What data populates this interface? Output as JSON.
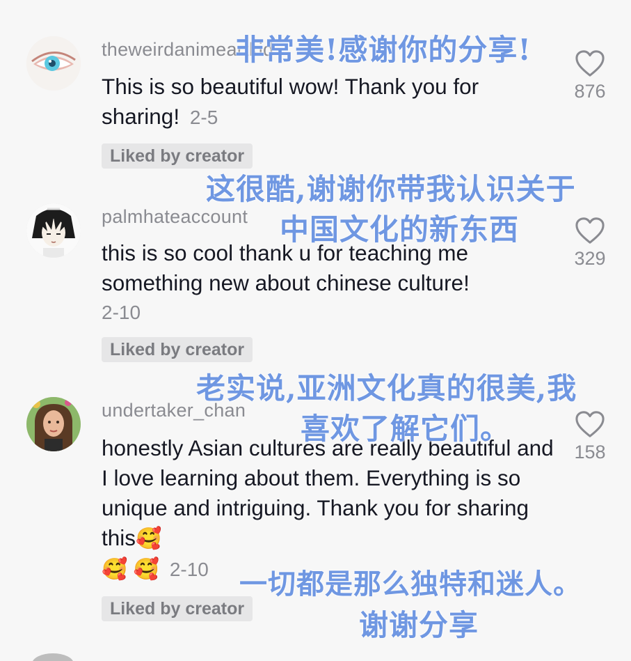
{
  "comments": [
    {
      "username": "theweirdanimeartkid",
      "text": "This is so beautiful wow! Thank you for sharing!",
      "date": "2-5",
      "badge": "Liked by creator",
      "likes": "876",
      "translation": "非常美!感谢你的分享!",
      "avatar_icon": "eye-avatar"
    },
    {
      "username": "palmhateaccount",
      "text": "this is so cool thank u for teaching me something new about chinese culture!",
      "date": "2-10",
      "badge": "Liked by creator",
      "likes": "329",
      "translation_1": "这很酷,谢谢你带我认识关于",
      "translation_2": "中国文化的新东西",
      "avatar_icon": "anime-character-avatar"
    },
    {
      "username": "undertaker_chan",
      "text": "honestly Asian cultures are really beautiful and I love learning about them. Everything is so unique and intriguing. Thank you for sharing this",
      "emojis_inline": "🥰",
      "emojis_line": "🥰 🥰",
      "date": "2-10",
      "badge": "Liked by creator",
      "likes": "158",
      "translation_1": "老实说,亚洲文化真的很美,我",
      "translation_2": "喜欢了解它们。",
      "translation_3": "一切都是那么独特和迷人。",
      "translation_4": "谢谢分享",
      "avatar_icon": "person-photo-avatar"
    }
  ],
  "colors": {
    "background": "#f7f7f7",
    "translation": "#6f97e2",
    "secondary_text": "#8a8b91",
    "badge_bg": "#e6e6e7"
  }
}
